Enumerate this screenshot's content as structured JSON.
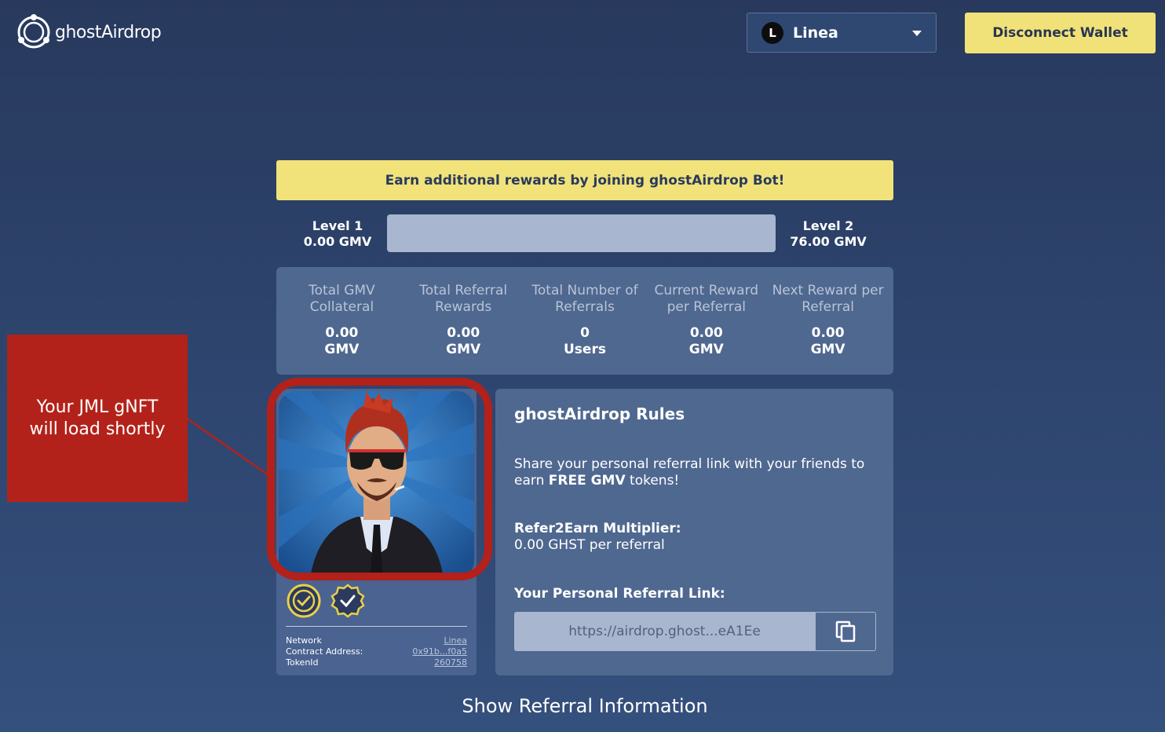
{
  "header": {
    "logo_text": "ghostAirdrop",
    "network": {
      "icon_letter": "L",
      "label": "Linea"
    },
    "disconnect_label": "Disconnect Wallet"
  },
  "banner": {
    "text": "Earn additional rewards by joining ghostAirdrop Bot!"
  },
  "levels": {
    "current": {
      "name": "Level 1",
      "value": "0.00 GMV"
    },
    "next": {
      "name": "Level 2",
      "value": "76.00 GMV"
    },
    "progress_fraction": 0
  },
  "stats": [
    {
      "label": "Total GMV Collateral",
      "amount": "0.00",
      "unit": "GMV"
    },
    {
      "label": "Total Referral Rewards",
      "amount": "0.00",
      "unit": "GMV"
    },
    {
      "label": "Total Number of Referrals",
      "amount": "0",
      "unit": "Users"
    },
    {
      "label": "Current Reward per Referral",
      "amount": "0.00",
      "unit": "GMV"
    },
    {
      "label": "Next Reward per Referral",
      "amount": "0.00",
      "unit": "GMV"
    }
  ],
  "nft": {
    "badges": [
      "verified-seal-icon",
      "checkmark-badge-icon"
    ],
    "meta": {
      "network_label": "Network",
      "network_value": "Linea",
      "contract_label": "Contract Address:",
      "contract_value": "0x91b...f0a5",
      "token_label": "TokenId",
      "token_value": "260758"
    }
  },
  "callout": {
    "text": "Your JML gNFT will load shortly"
  },
  "rules": {
    "title": "ghostAirdrop Rules",
    "share_text_before": "Share your personal referral link with your friends to earn ",
    "share_text_bold": "FREE GMV",
    "share_text_after": " tokens!",
    "multiplier_title": "Refer2Earn Multiplier:",
    "multiplier_value": "0.00 GHST per referral",
    "link_title": "Your Personal Referral Link:",
    "link_value": "https://airdrop.ghost...eA1Ee"
  },
  "footer": {
    "show_referral_label": "Show Referral Information"
  },
  "colors": {
    "accent_yellow": "#f0e278",
    "panel": "#4f6890",
    "callout_red": "#b3221a",
    "background": "#2e4670"
  }
}
